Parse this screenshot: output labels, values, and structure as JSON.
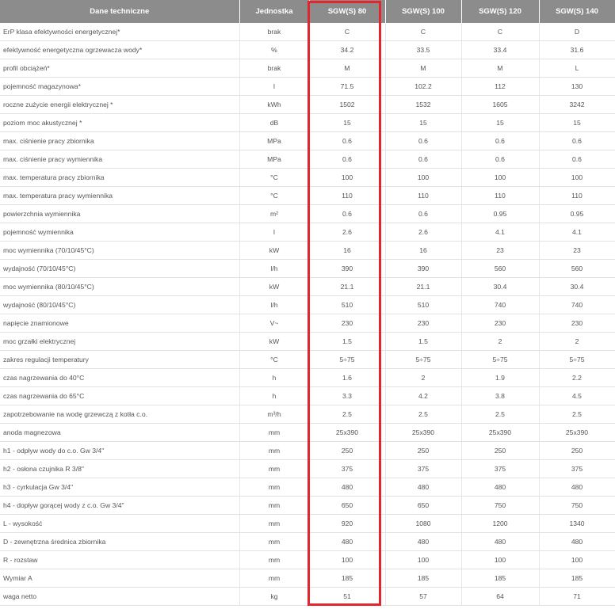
{
  "headers": [
    "Dane techniczne",
    "Jednostka",
    "SGW(S) 80",
    "SGW(S) 100",
    "SGW(S) 120",
    "SGW(S) 140"
  ],
  "rows": [
    [
      "ErP klasa efektywności energetycznej*",
      "brak",
      "C",
      "C",
      "C",
      "D"
    ],
    [
      "efektywność energetyczna ogrzewacza wody*",
      "%",
      "34.2",
      "33.5",
      "33.4",
      "31.6"
    ],
    [
      "profil obciążeń*",
      "brak",
      "M",
      "M",
      "M",
      "L"
    ],
    [
      "pojemność magazynowa*",
      "l",
      "71.5",
      "102.2",
      "112",
      "130"
    ],
    [
      "roczne zużycie energii elektrycznej *",
      "kWh",
      "1502",
      "1532",
      "1605",
      "3242"
    ],
    [
      "poziom moc akustycznej *",
      "dB",
      "15",
      "15",
      "15",
      "15"
    ],
    [
      "max. ciśnienie pracy zbiornika",
      "MPa",
      "0.6",
      "0.6",
      "0.6",
      "0.6"
    ],
    [
      "max. ciśnienie pracy wymiennika",
      "MPa",
      "0.6",
      "0.6",
      "0.6",
      "0.6"
    ],
    [
      "max. temperatura pracy zbiornika",
      "°C",
      "100",
      "100",
      "100",
      "100"
    ],
    [
      "max. temperatura pracy wymiennika",
      "°C",
      "110",
      "110",
      "110",
      "110"
    ],
    [
      "powierzchnia wymiennika",
      "m²",
      "0.6",
      "0.6",
      "0.95",
      "0.95"
    ],
    [
      "pojemność wymiennika",
      "l",
      "2.6",
      "2.6",
      "4.1",
      "4.1"
    ],
    [
      "moc wymiennika (70/10/45°C)",
      "kW",
      "16",
      "16",
      "23",
      "23"
    ],
    [
      "wydajność (70/10/45°C)",
      "l/h",
      "390",
      "390",
      "560",
      "560"
    ],
    [
      "moc wymiennika (80/10/45°C)",
      "kW",
      "21.1",
      "21.1",
      "30.4",
      "30.4"
    ],
    [
      "wydajność (80/10/45°C)",
      "l/h",
      "510",
      "510",
      "740",
      "740"
    ],
    [
      "napięcie znamionowe",
      "V~",
      "230",
      "230",
      "230",
      "230"
    ],
    [
      "moc grzałki elektrycznej",
      "kW",
      "1.5",
      "1.5",
      "2",
      "2"
    ],
    [
      "zakres regulacji temperatury",
      "°C",
      "5÷75",
      "5÷75",
      "5÷75",
      "5÷75"
    ],
    [
      "czas nagrzewania do 40°C",
      "h",
      "1.6",
      "2",
      "1.9",
      "2.2"
    ],
    [
      "czas nagrzewania do 65°C",
      "h",
      "3.3",
      "4.2",
      "3.8",
      "4.5"
    ],
    [
      "zapotrzebowanie na wodę grzewczą z kotła c.o.",
      "m³/h",
      "2.5",
      "2.5",
      "2.5",
      "2.5"
    ],
    [
      "anoda magnezowa",
      "mm",
      "25x390",
      "25x390",
      "25x390",
      "25x390"
    ],
    [
      "h1 - odpływ wody do c.o. Gw 3/4\"",
      "mm",
      "250",
      "250",
      "250",
      "250"
    ],
    [
      "h2 - osłona czujnika R 3/8\"",
      "mm",
      "375",
      "375",
      "375",
      "375"
    ],
    [
      "h3 - cyrkulacja Gw 3/4\"",
      "mm",
      "480",
      "480",
      "480",
      "480"
    ],
    [
      "h4 - dopływ gorącej wody z c.o. Gw 3/4\"",
      "mm",
      "650",
      "650",
      "750",
      "750"
    ],
    [
      "L - wysokość",
      "mm",
      "920",
      "1080",
      "1200",
      "1340"
    ],
    [
      "D - zewnętrzna średnica zbiornika",
      "mm",
      "480",
      "480",
      "480",
      "480"
    ],
    [
      "R - rozstaw",
      "mm",
      "100",
      "100",
      "100",
      "100"
    ],
    [
      "Wymiar A",
      "mm",
      "185",
      "185",
      "185",
      "185"
    ],
    [
      "waga netto",
      "kg",
      "51",
      "57",
      "64",
      "71"
    ]
  ],
  "colors": {
    "header_bg": "#8c8c8c",
    "highlight": "#e3262d"
  }
}
